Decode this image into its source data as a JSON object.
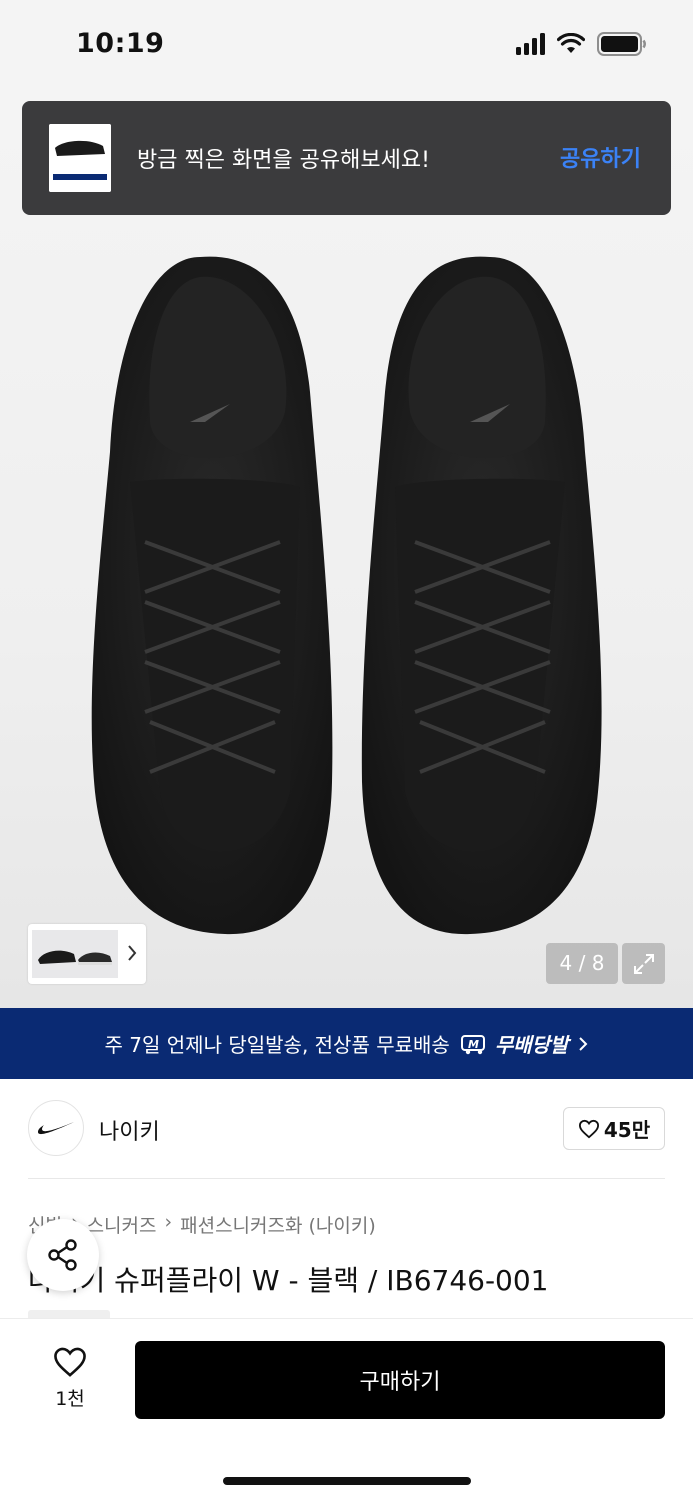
{
  "status_bar": {
    "time": "10:19"
  },
  "toast": {
    "message": "방금 찍은 화면을 공유해보세요!",
    "action_label": "공유하기"
  },
  "gallery": {
    "counter": "4 / 8",
    "current_index": 4,
    "total": 8
  },
  "banner": {
    "text": "주 7일 언제나 당일발송, 전상품 무료배송",
    "brand_label": "무배당발"
  },
  "brand": {
    "name": "나이키",
    "like_count": "45만"
  },
  "breadcrumb": [
    "신발",
    "스니커즈",
    "패션스니커즈화 (나이키)"
  ],
  "product": {
    "title": "나이키 슈퍼플라이 W - 블랙 / IB6746-001"
  },
  "bottom_bar": {
    "wish_count": "1천",
    "buy_label": "구매하기"
  },
  "colors": {
    "banner_bg": "#0a2a73",
    "toast_bg": "#3b3b3d",
    "toast_action": "#3b82f6",
    "buy_bg": "#000000"
  },
  "icons": [
    "signal-icon",
    "wifi-icon",
    "battery-icon",
    "chevron-right-icon",
    "expand-icon",
    "heart-icon",
    "share-icon",
    "nike-swoosh-icon"
  ]
}
